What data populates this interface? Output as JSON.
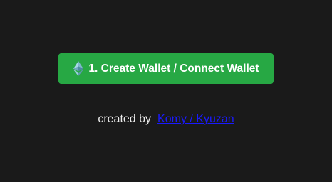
{
  "main_button": {
    "icon": "ethereum-icon",
    "label": "1. Create Wallet / Connect Wallet",
    "color": "#27a844"
  },
  "credit": {
    "prefix": "created by",
    "link_text": "Komy / Kyuzan",
    "link_color": "#1a1aff"
  },
  "colors": {
    "background": "#1a1a1a"
  }
}
